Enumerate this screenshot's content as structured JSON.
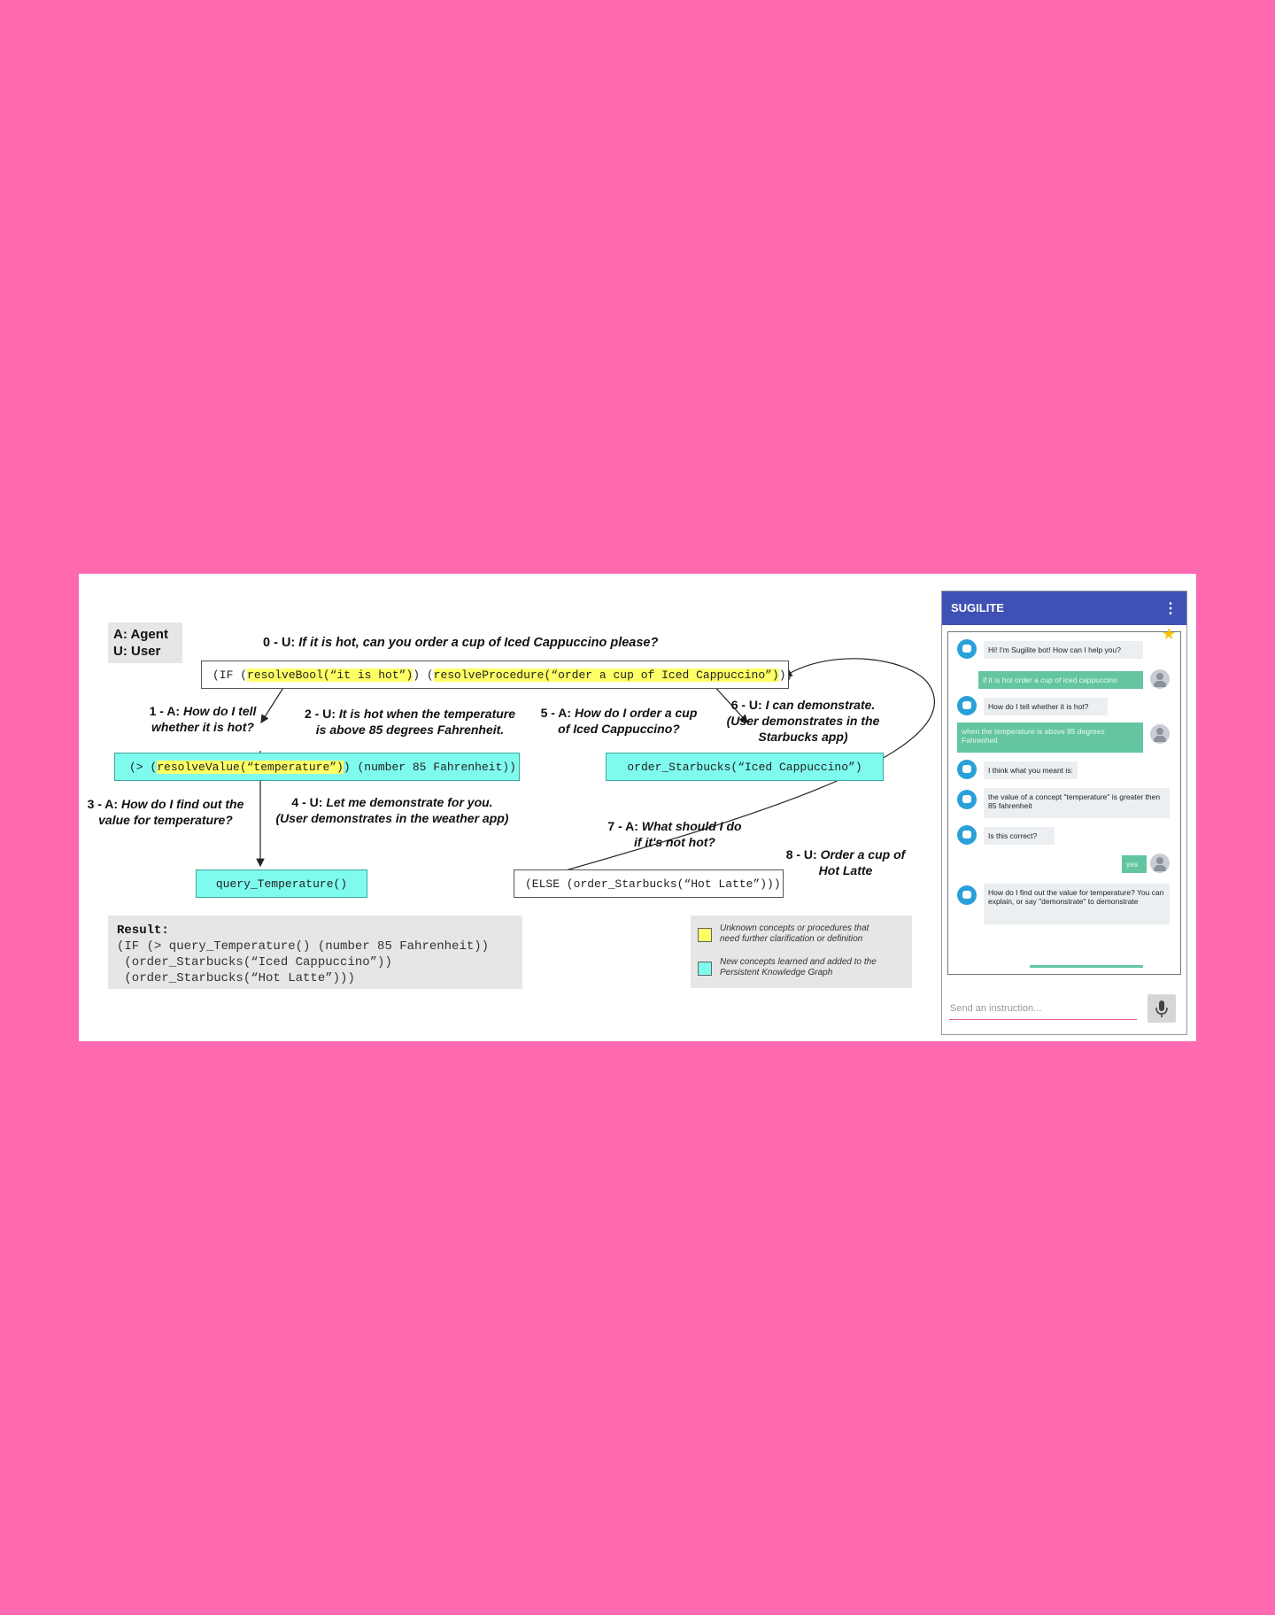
{
  "legend_roles": {
    "agent": "A:  Agent",
    "user": "U:  User"
  },
  "steps": {
    "s0": {
      "prefix": "0 - U: ",
      "text": "If it is hot, can you order a cup of Iced Cappuccino please?"
    },
    "s1": {
      "prefix": "1 - A: ",
      "text_a": "How do I tell",
      "text_b": "whether it is hot?"
    },
    "s2": {
      "prefix": "2 - U: ",
      "text_a": "It is hot when the temperature",
      "text_b": "is above 85 degrees Fahrenheit."
    },
    "s3": {
      "prefix": "3 - A: ",
      "text_a": "How do I find out the",
      "text_b": "value for temperature?"
    },
    "s4": {
      "prefix": "4 - U: ",
      "text_a": "Let me demonstrate for you.",
      "text_b": "(User demonstrates in the weather app)"
    },
    "s5": {
      "prefix": "5 - A: ",
      "text_a": "How do I order a cup",
      "text_b": "of Iced Cappuccino?"
    },
    "s6": {
      "prefix": "6 - U: ",
      "text_a": "I can demonstrate.",
      "text_b": "(User demonstrates in the",
      "text_c": "Starbucks app)"
    },
    "s7": {
      "prefix": "7 - A: ",
      "text_a": "What should I do",
      "text_b": "if it's not hot?"
    },
    "s8": {
      "prefix": "8 - U: ",
      "text_a": "Order a cup of",
      "text_b": "Hot Latte"
    }
  },
  "code": {
    "top_a": "(IF (",
    "top_hl1": "resolveBool(“it is hot”)",
    "top_b": ") (",
    "top_hl2": "resolveProcedure(“order a cup of Iced Cappuccino”)",
    "top_c": "))",
    "cond_a": "(> (",
    "cond_hl": "resolveValue(“temperature”)",
    "cond_b": ") (number 85 Fahrenheit))",
    "order": "order_Starbucks(“Iced Cappuccino”)",
    "query": "query_Temperature()",
    "else": "(ELSE (order_Starbucks(“Hot Latte”)))"
  },
  "result": {
    "title": "Result:",
    "line1": "(IF (> query_Temperature() (number 85 Fahrenheit))",
    "line2": " (order_Starbucks(“Iced Cappuccino”))",
    "line3": " (order_Starbucks(“Hot Latte”)))"
  },
  "color_legend": {
    "unknown_a": "Unknown concepts or procedures that",
    "unknown_b": "need further clarification or definition",
    "new_a": "New concepts learned and added to the",
    "new_b": "Persistent Knowledge Graph",
    "unknown_color": "#ffff66",
    "new_color": "#7ffbee"
  },
  "phone": {
    "title": "SUGILITE",
    "menu_icon": "⋮",
    "messages": [
      {
        "from": "bot",
        "text": "Hi! I'm Sugilite bot! How can I help you?"
      },
      {
        "from": "user",
        "text": "if it is hot order a cup of iced cappuccino"
      },
      {
        "from": "bot",
        "text": "How do I tell whether it is hot?"
      },
      {
        "from": "user",
        "text": "when the temperature is above 85 degrees Fahrenheit"
      },
      {
        "from": "bot",
        "text": "I think what you meant is:"
      },
      {
        "from": "bot",
        "text": "the value of a concept \"temperature\" is greater then 85 fahrenheit"
      },
      {
        "from": "bot",
        "text": "Is this correct?"
      },
      {
        "from": "user",
        "text": "yes"
      },
      {
        "from": "bot",
        "text": "How do I find out the value for temperature? You can explain, or say \"demonstrate\" to demonstrate"
      }
    ],
    "input_placeholder": "Send an instruction..."
  }
}
